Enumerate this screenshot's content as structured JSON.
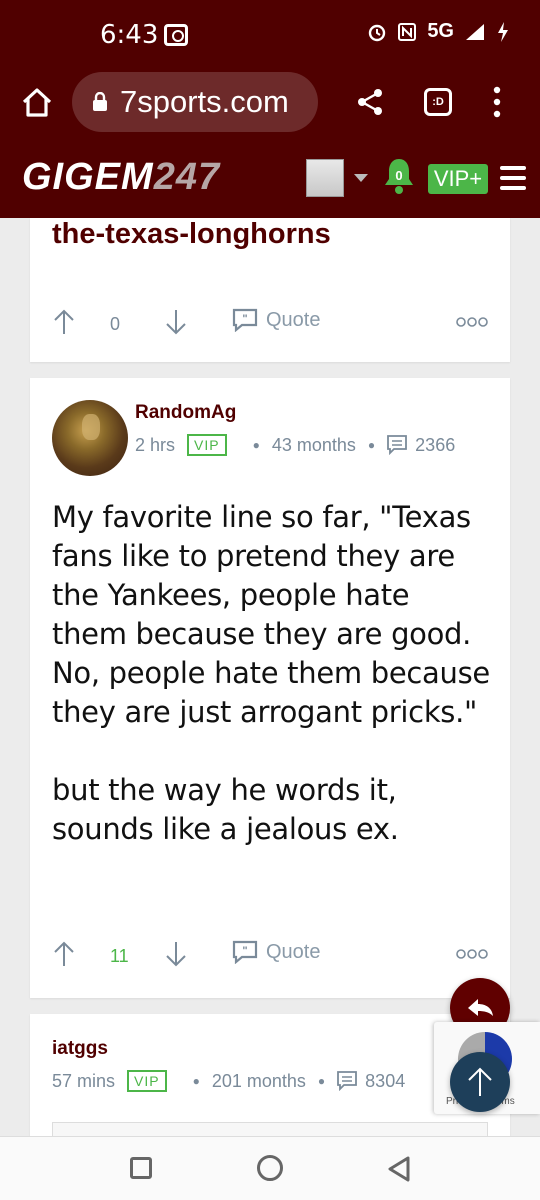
{
  "status_bar": {
    "time": "6:43",
    "network": "5G"
  },
  "browser": {
    "url": "7sports.com",
    "tab_label": ":D"
  },
  "site_header": {
    "logo_text": "GIGEM",
    "logo_number": "247",
    "notification_count": "0",
    "vip_label": "VIP+"
  },
  "post1": {
    "link_text": "the-texas-longhorns",
    "vote_count": "0",
    "quote_label": "Quote"
  },
  "post2": {
    "username": "RandomAg",
    "time": "2 hrs",
    "vip_badge": "VIP",
    "tenure": "43 months",
    "comment_count": "2366",
    "body": "My favorite line so far, \"Texas fans like to pretend they are the Yankees, people hate them because they are good. No, people hate them because they are just arrogant pricks.\"\n\nbut the way he words it, sounds like a jealous ex.",
    "vote_count": "11",
    "quote_label": "Quote"
  },
  "post3": {
    "username": "iatggs",
    "time": "57 mins",
    "vip_badge": "VIP",
    "tenure": "201 months",
    "comment_count": "8304"
  },
  "recaptcha": {
    "text": "Privacy - Terms"
  },
  "colors": {
    "brand": "#500000",
    "vip_green": "#4cb648",
    "fab_blue": "#1e3f5a"
  }
}
